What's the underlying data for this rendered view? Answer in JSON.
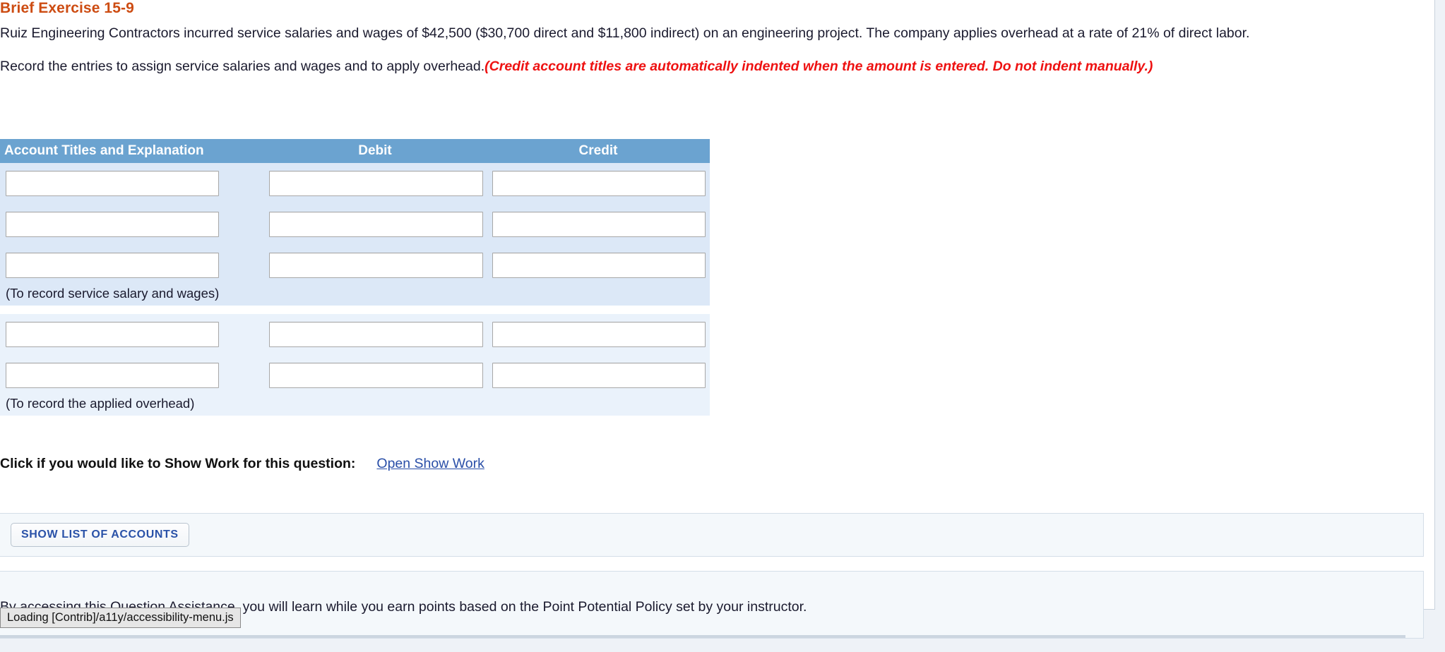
{
  "exercise": {
    "title": "Brief Exercise 15-9",
    "problem": "Ruiz Engineering Contractors incurred service salaries and wages of $42,500 ($30,700 direct and $11,800 indirect) on an engineering project. The company applies overhead at a rate of 21% of direct labor.",
    "instruction_plain": "Record the entries to assign service salaries and wages and to apply overhead.",
    "instruction_emphasis": "(Credit account titles are automatically indented when the amount is entered. Do not indent manually.)"
  },
  "journal": {
    "columns": {
      "account": "Account Titles and Explanation",
      "debit": "Debit",
      "credit": "Credit"
    },
    "entries": [
      {
        "rows": [
          {
            "account": "",
            "debit": "",
            "credit": ""
          },
          {
            "account": "",
            "debit": "",
            "credit": ""
          },
          {
            "account": "",
            "debit": "",
            "credit": ""
          }
        ],
        "explanation": "(To record service salary and wages)"
      },
      {
        "rows": [
          {
            "account": "",
            "debit": "",
            "credit": ""
          },
          {
            "account": "",
            "debit": "",
            "credit": ""
          }
        ],
        "explanation": "(To record the applied overhead)"
      }
    ],
    "input_placeholder": ""
  },
  "show_work": {
    "label": "Click if you would like to Show Work for this question:",
    "link": "Open Show Work"
  },
  "accounts": {
    "button_label": "SHOW LIST OF ACCOUNTS"
  },
  "assistance": {
    "underlined_part": "By accessing this Question Assistance",
    "rest": ", you will learn while you earn points based on the Point Potential Policy set by your instructor."
  },
  "status": {
    "mathjax_loading": "Loading [Contrib]/a11y/accessibility-menu.js"
  },
  "colors": {
    "title": "#cd4c12",
    "emphasis": "#ee1111",
    "table_header_bg": "#6ba3d0",
    "group_a_bg": "#dce8f7",
    "group_b_bg": "#eaf2fb",
    "link": "#2a4fa8",
    "button_text": "#2a52a8",
    "panel_bg": "#f4f8fb"
  }
}
